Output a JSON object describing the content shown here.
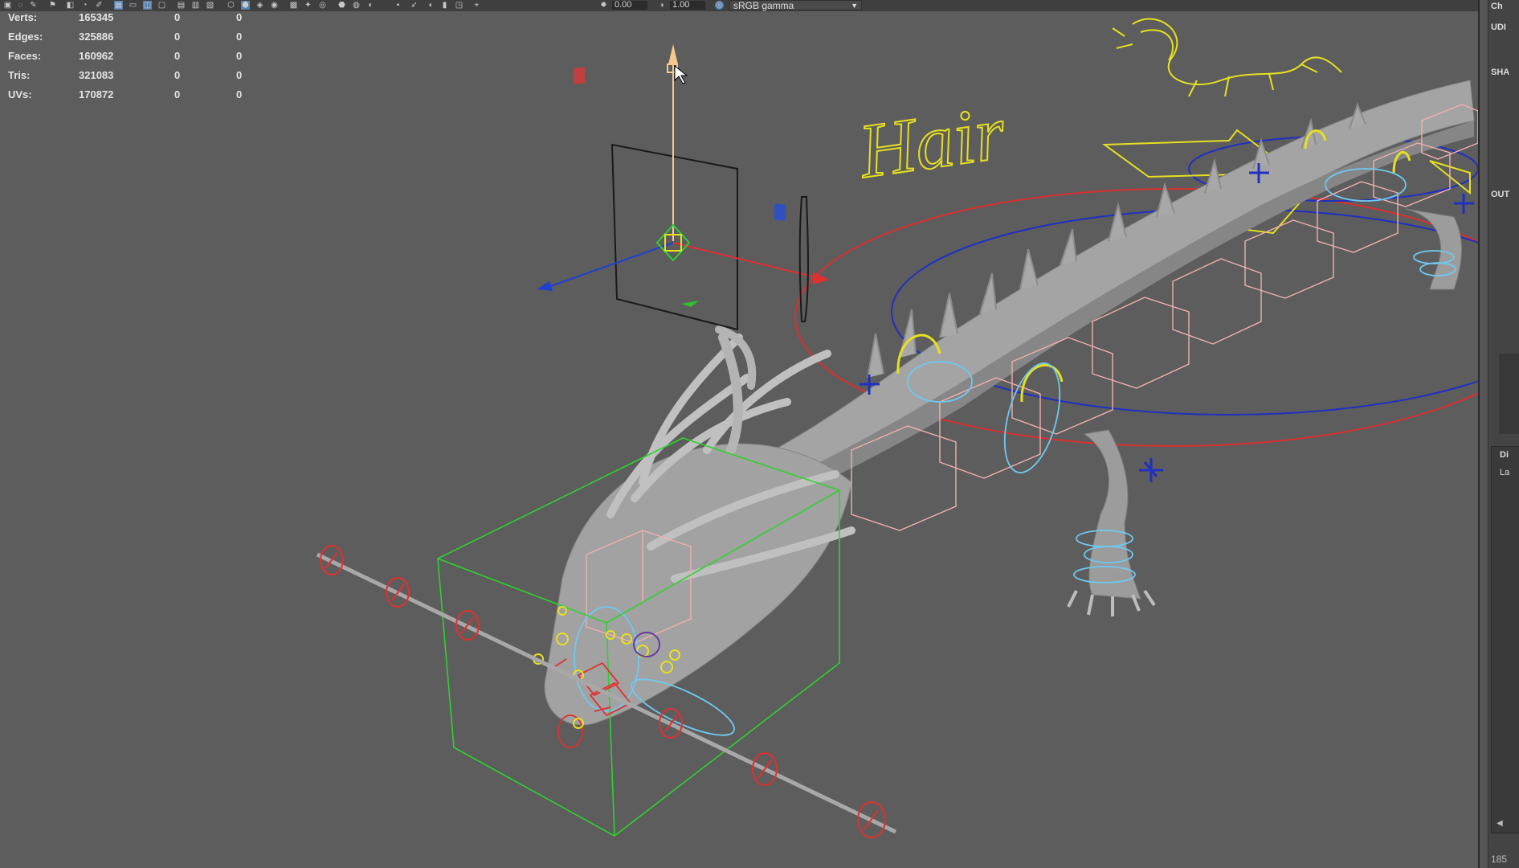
{
  "toolbar": {
    "exposure_value": "0.00",
    "gamma_value": "1.00",
    "color_space": "sRGB gamma",
    "icons": [
      "select-icon",
      "lasso-icon",
      "paint-icon",
      "bookmark-icon",
      "camera-icon",
      "grid-icon",
      "film-gate-icon",
      "resolution-gate-icon",
      "wireframe-icon",
      "smooth-shade-icon",
      "textured-icon",
      "lighting-icon",
      "shadows-icon",
      "isolate-icon",
      "xray-icon",
      "exposure-icon",
      "gamma-icon",
      "color-space-icon"
    ]
  },
  "hud": {
    "rows": [
      {
        "label": "Verts:",
        "total": "165345",
        "selected": "0",
        "sel_comp": "0"
      },
      {
        "label": "Edges:",
        "total": "325886",
        "selected": "0",
        "sel_comp": "0"
      },
      {
        "label": "Faces:",
        "total": "160962",
        "selected": "0",
        "sel_comp": "0"
      },
      {
        "label": "Tris:",
        "total": "321083",
        "selected": "0",
        "sel_comp": "0"
      },
      {
        "label": "UVs:",
        "total": "170872",
        "selected": "0",
        "sel_comp": "0"
      }
    ]
  },
  "viewport": {
    "hair_label": "Hair"
  },
  "right_panel": {
    "labels": [
      "Ch",
      "UDI",
      "SHA",
      "OUT",
      "Di",
      "La"
    ],
    "frame": "185"
  },
  "colors": {
    "background": "#5d5d5d",
    "control_red": "#e03030",
    "control_blue": "#2030c0",
    "control_yellow": "#e6e020",
    "control_cyan": "#70c8f0",
    "control_pink": "#f0b0b0",
    "bbox_green": "#30d030",
    "mesh_gray": "#9a9a9a"
  }
}
